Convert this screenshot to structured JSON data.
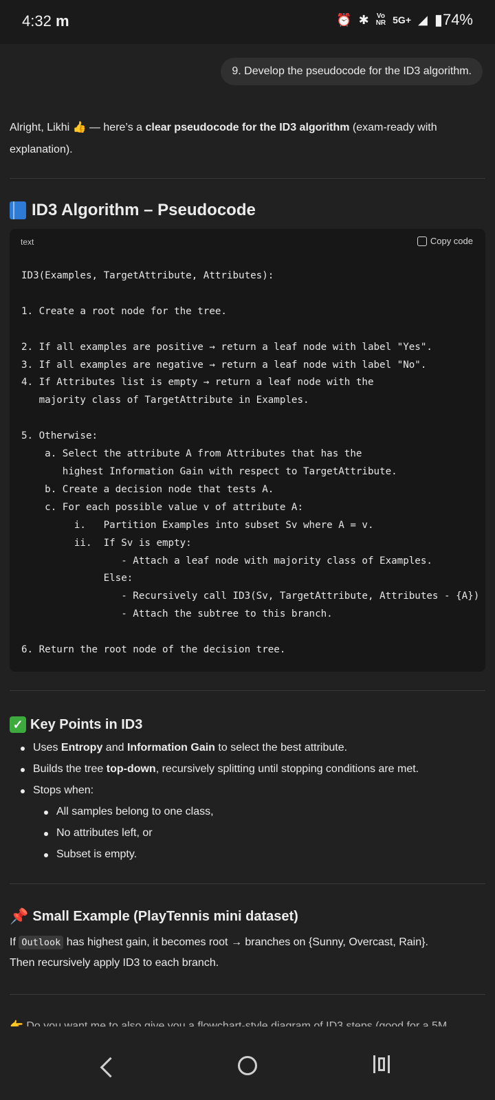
{
  "status_bar": {
    "time": "4:32",
    "carrier_icon": "m",
    "volte": "Vo",
    "nr": "NR",
    "network": "5G+",
    "battery": "74%"
  },
  "user_message": "9. Develop the pseudocode for the ID3 algorithm.",
  "intro": {
    "part1": "Alright, Likhi ",
    "emoji": "👍",
    "part2": " — here’s a ",
    "bold": "clear pseudocode for the ID3 algorithm",
    "part3": " (exam-ready with explanation)."
  },
  "section1": {
    "title": "ID3 Algorithm – Pseudocode"
  },
  "code_block": {
    "language": "text",
    "copy_label": "Copy code",
    "lines": [
      "ID3(Examples, TargetAttribute, Attributes):",
      "",
      "1. Create a root node for the tree.",
      "",
      "2. If all examples are positive → return a leaf node with label \"Yes\".",
      "3. If all examples are negative → return a leaf node with label \"No\".",
      "4. If Attributes list is empty → return a leaf node with the",
      "   majority class of TargetAttribute in Examples.",
      "",
      "5. Otherwise:",
      "    a. Select the attribute A from Attributes that has the",
      "       highest Information Gain with respect to TargetAttribute.",
      "    b. Create a decision node that tests A.",
      "    c. For each possible value v of attribute A:",
      "         i.   Partition Examples into subset Sv where A = v.",
      "         ii.  If Sv is empty:",
      "                 - Attach a leaf node with majority class of Examples.",
      "              Else:",
      "                 - Recursively call ID3(Sv, TargetAttribute, Attributes - {A})",
      "                 - Attach the subtree to this branch.",
      "",
      "6. Return the root node of the decision tree."
    ]
  },
  "section2": {
    "title": "Key Points in ID3",
    "bullets": [
      {
        "pre": "Uses ",
        "b1": "Entropy",
        "mid": " and ",
        "b2": "Information Gain",
        "post": " to select the best attribute."
      },
      {
        "pre": "Builds the tree ",
        "b1": "top-down",
        "post": ", recursively splitting until stopping conditions are met."
      },
      {
        "pre": "Stops when:"
      }
    ],
    "sub_bullets": [
      "All samples belong to one class,",
      "No attributes left, or",
      "Subset is empty."
    ]
  },
  "section3": {
    "title": "Small Example (PlayTennis mini dataset)",
    "line1_pre": "If ",
    "line1_code": "Outlook",
    "line1_post": " has highest gain, it becomes root → branches on {Sunny, Overcast, Rain}.",
    "line2": "Then recursively apply ID3 to each branch."
  },
  "followup_cutoff": "👉 Do you want me to also give you a flowchart-style diagram of ID3 steps (good for a 5M"
}
